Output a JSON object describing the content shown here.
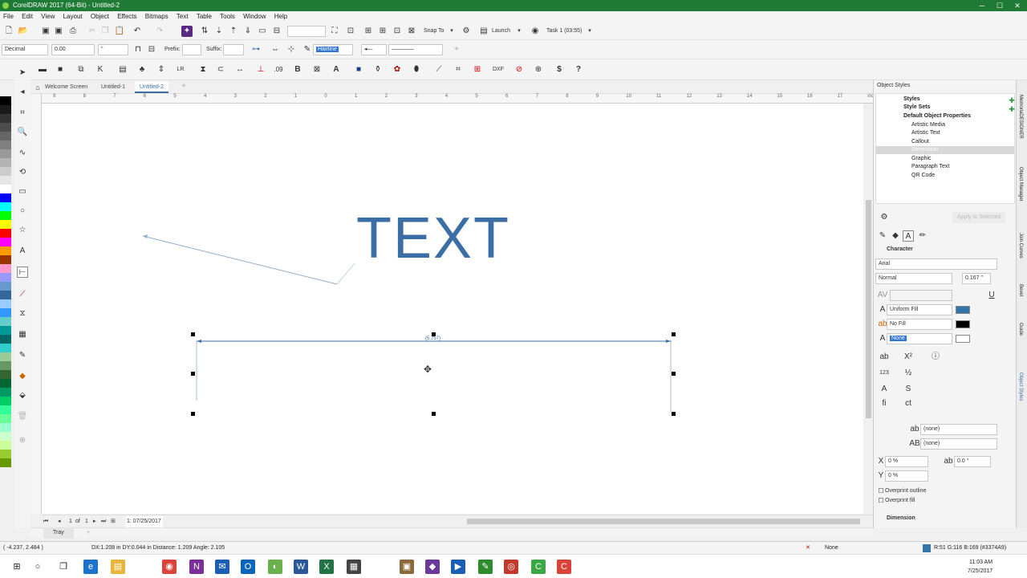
{
  "app": {
    "title": "CorelDRAW 2017 (64-Bit) - Untitled-2"
  },
  "window_controls": {
    "minimize": "─",
    "maximize": "☐",
    "close": "✕"
  },
  "menu": [
    "File",
    "Edit",
    "View",
    "Layout",
    "Object",
    "Effects",
    "Bitmaps",
    "Text",
    "Table",
    "Tools",
    "Window",
    "Help"
  ],
  "toolbar": {
    "snap_to": "Snap To",
    "launch": "Launch",
    "task": "Task 1 (03:55)"
  },
  "propbar": {
    "units": "Decimal",
    "precision": "0.00",
    "unit_sym": "\"",
    "prefix_label": "Prefix:",
    "suffix_label": "Suffix:",
    "outline": "Hairline"
  },
  "tabs": [
    "Welcome Screen",
    "Untitled-1",
    "Untitled-2"
  ],
  "ruler_h": [
    "9",
    "8",
    "7",
    "6",
    "5",
    "4",
    "3",
    "2",
    "1",
    "0",
    "1",
    "2",
    "3",
    "4",
    "5",
    "6",
    "7",
    "8",
    "9",
    "10",
    "11",
    "12",
    "13",
    "14",
    "15",
    "16",
    "17",
    "inches"
  ],
  "canvas": {
    "text": "TEXT",
    "text_color": "#3b6ea5",
    "dimension_label": "(5.757)"
  },
  "page_nav": {
    "current": "1",
    "of": "of",
    "total": "1",
    "page_label": "1: 07/25/2017"
  },
  "tray": "Tray",
  "status": {
    "coords": "( -4.237, 2.484 )",
    "message": "DX:1.208 in DY:0.044 in Distance: 1.209 Angle: 2.105",
    "fill_none": "None",
    "color_info": "R:51 G:116 B:169 (#3374A9)"
  },
  "docker": {
    "title": "Object Styles",
    "tree": [
      {
        "label": "Styles",
        "bold": true,
        "indent": 0
      },
      {
        "label": "Style Sets",
        "bold": true,
        "indent": 0
      },
      {
        "label": "Default Object Properties",
        "bold": true,
        "indent": 0
      },
      {
        "label": "Artistic Media",
        "bold": false,
        "indent": 1
      },
      {
        "label": "Artistic Text",
        "bold": false,
        "indent": 1
      },
      {
        "label": "Callout",
        "bold": false,
        "indent": 1
      },
      {
        "label": "Dimension",
        "bold": false,
        "indent": 1,
        "selected": true
      },
      {
        "label": "Graphic",
        "bold": false,
        "indent": 1
      },
      {
        "label": "Paragraph Text",
        "bold": false,
        "indent": 1
      },
      {
        "label": "QR Code",
        "bold": false,
        "indent": 1
      }
    ],
    "apply_btn": "Apply to Selected",
    "character_header": "Character",
    "font": "Arial",
    "style": "Normal",
    "size": "0.167 \"",
    "fill_type": "Uniform Fill",
    "bg_fill": "No Fill",
    "outline": "None",
    "none1": "(none)",
    "none2": "(none)",
    "x_val": "0 %",
    "y_val": "0 %",
    "rot_val": "0.0 °",
    "overprint_outline": "Overprint outline",
    "overprint_fill": "Overprint fill",
    "dimension_header": "Dimension"
  },
  "side_tabs": [
    "MemoriaDESIGNER",
    "Object Manager",
    "Join Curves",
    "Bevel",
    "Guide",
    "Object Styles"
  ],
  "clock": {
    "time": "11:03 AM",
    "date": "7/25/2017"
  },
  "palette_colors": [
    "#000000",
    "#1a1a1a",
    "#333333",
    "#4d4d4d",
    "#666666",
    "#808080",
    "#999999",
    "#b3b3b3",
    "#cccccc",
    "#e6e6e6",
    "#ffffff",
    "#0000ff",
    "#00ffff",
    "#00ff00",
    "#ffff00",
    "#ff0000",
    "#ff00ff",
    "#ff9900",
    "#993300",
    "#ff99cc",
    "#9999ff",
    "#6699cc",
    "#336699",
    "#99ccff",
    "#3399ff",
    "#66cccc",
    "#009999",
    "#006666",
    "#33cccc",
    "#99cc99",
    "#669966",
    "#336633",
    "#006633",
    "#009966",
    "#00cc66",
    "#33ff99",
    "#66ff99",
    "#99ffcc",
    "#ccffcc",
    "#ccff99",
    "#99cc33",
    "#669900"
  ]
}
